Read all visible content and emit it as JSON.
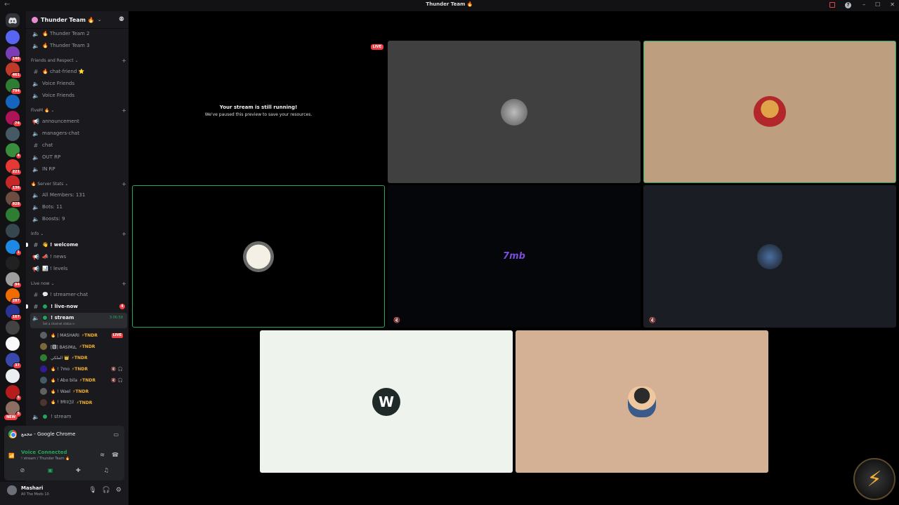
{
  "window": {
    "title": "Thunder Team 🔥"
  },
  "rail": {
    "servers": [
      {
        "badge": ""
      },
      {
        "badge": "146"
      },
      {
        "badge": "461"
      },
      {
        "badge": "794"
      },
      {
        "badge": ""
      },
      {
        "badge": "74"
      },
      {
        "badge": ""
      },
      {
        "badge": "4"
      },
      {
        "badge": "221"
      },
      {
        "badge": "136"
      },
      {
        "badge": "928"
      },
      {
        "badge": ""
      },
      {
        "badge": ""
      },
      {
        "badge": "1"
      },
      {
        "badge": ""
      },
      {
        "badge": "94"
      },
      {
        "badge": "287"
      },
      {
        "badge": "167"
      },
      {
        "badge": ""
      },
      {
        "badge": ""
      },
      {
        "badge": "37"
      },
      {
        "badge": ""
      },
      {
        "badge": "5"
      },
      {
        "badge": "5"
      }
    ],
    "new_label": "NEW"
  },
  "server": {
    "name": "Thunder Team 🔥"
  },
  "channels": {
    "top": [
      {
        "name": "🔥 Thunder Team 2"
      },
      {
        "name": "🔥 Thunder Team 3"
      }
    ],
    "cat_friends": "Friends and Respect",
    "friends": [
      {
        "name": "🔥 chat-friend ⭐"
      },
      {
        "name": "Voice Friends"
      },
      {
        "name": "Voice Friends"
      }
    ],
    "cat_fivem": "FiveM 🔥",
    "fivem": [
      {
        "name": "announcement"
      },
      {
        "name": "managers-chat"
      },
      {
        "name": "chat"
      },
      {
        "name": "OUT RP"
      },
      {
        "name": "IN RP"
      }
    ],
    "cat_stats": "🔥 Server Stats",
    "stats": [
      {
        "name": "All Members: 131"
      },
      {
        "name": "Bots: 11"
      },
      {
        "name": "Boosts: 9"
      }
    ],
    "cat_info": "Info",
    "info": [
      {
        "name": "👋 ! welcome"
      },
      {
        "name": "📣 ! news"
      },
      {
        "name": "📊 ! levels"
      }
    ],
    "cat_live": "Live now",
    "live": [
      {
        "name": "💬 ! streamer-chat"
      },
      {
        "name": "! live-now"
      }
    ],
    "live_now_mentions": "4",
    "stream_channel": "! stream",
    "stream_time": "3:06:58",
    "stream_status": "Set a channel status ✏",
    "voice_users": [
      {
        "name": "🔥 | MASHARI",
        "tag": "⚡TNDR",
        "live": "LIVE"
      },
      {
        "name": "[🅱] BASIM∆,",
        "tag": "⚡TNDR",
        "live": ""
      },
      {
        "name": "الملكي 👑",
        "tag": "⚡TNDR",
        "live": ""
      },
      {
        "name": "🔥 ! 7mo",
        "tag": "⚡TNDR",
        "live": ""
      },
      {
        "name": "🔥 ! Abo bila",
        "tag": "⚡TNDR",
        "live": ""
      },
      {
        "name": "🔥 ! Wael",
        "tag": "⚡TNDR",
        "live": ""
      },
      {
        "name": "🔥 ! 𝔅𝔄𝔖𝔍𝔏",
        "tag": "⚡TNDR",
        "live": ""
      }
    ],
    "stream2": "! stream"
  },
  "panel": {
    "chrome_label": "مجمع - Google Chrome",
    "voice_connected": "Voice Connected",
    "voice_sub": "! stream / Thunder Team 🔥",
    "username": "Mashari",
    "user_status": "All The Mods 10"
  },
  "stage": {
    "live_badge": "LIVE",
    "paused_title": "Your stream is still running!",
    "paused_sub": "We've paused this preview to save your resources.",
    "tile_7mo_text": "7mb"
  },
  "colors": {
    "accent_green": "#23a55a",
    "live_red": "#f23f43",
    "tile_gray": "#404040",
    "tile_tan": "#bd9e7f",
    "tile_navy": "#1a1d23",
    "tile_white": "#eef3ee",
    "tile_peach": "#d4b094"
  }
}
